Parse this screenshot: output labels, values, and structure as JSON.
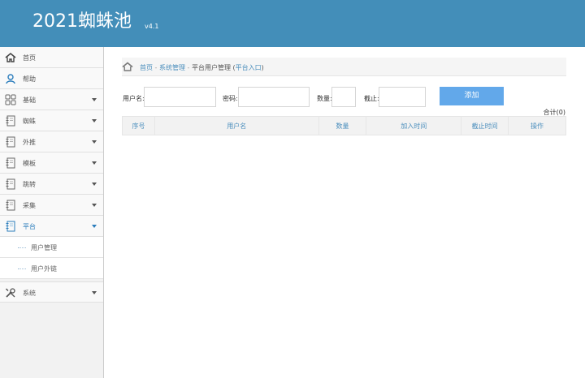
{
  "header": {
    "brand": "2021蜘蛛池",
    "version": "v4.1"
  },
  "sidebar": {
    "items": [
      {
        "label": "首页",
        "icon": "home-icon"
      },
      {
        "label": "帮助",
        "icon": "user-help-icon"
      },
      {
        "label": "基础",
        "icon": "grid-icon",
        "caret": true
      },
      {
        "label": "蜘蛛",
        "icon": "notebook-icon",
        "caret": true
      },
      {
        "label": "外推",
        "icon": "notebook-icon",
        "caret": true
      },
      {
        "label": "模板",
        "icon": "notebook-icon",
        "caret": true
      },
      {
        "label": "跳转",
        "icon": "notebook-icon",
        "caret": true
      },
      {
        "label": "采集",
        "icon": "notebook-icon",
        "caret": true
      },
      {
        "label": "平台",
        "icon": "notebook-icon",
        "caret": true,
        "active": true
      }
    ],
    "sub_items": [
      {
        "label": "用户管理"
      },
      {
        "label": "用户外链"
      }
    ],
    "system": {
      "label": "系统",
      "icon": "tools-icon"
    }
  },
  "breadcrumb": {
    "home": "首页",
    "sep1": " - ",
    "section": "系统管理",
    "sep2": " - ",
    "current": "平台用户管理 (",
    "link": "平台入口",
    "close": ")"
  },
  "form": {
    "username_label": "用户名:",
    "password_label": "密码:",
    "quantity_label": "数量:",
    "deadline_label": "截止:",
    "username_value": "",
    "password_value": "",
    "quantity_value": "",
    "deadline_value": "",
    "add_label": "添加"
  },
  "total": "合计(0)",
  "table": {
    "columns": [
      "序号",
      "用户名",
      "数量",
      "加入时间",
      "截止时间",
      "操作"
    ]
  },
  "colors": {
    "header_bg": "#438eb9",
    "accent": "#4c8fbd",
    "button": "#62a8ea"
  }
}
